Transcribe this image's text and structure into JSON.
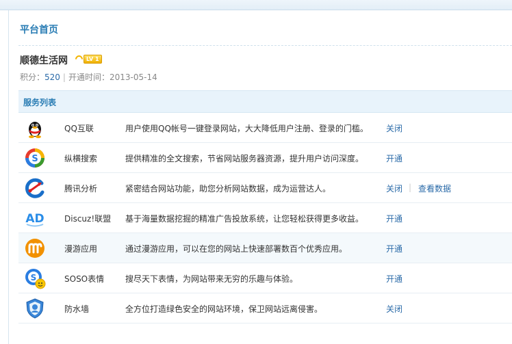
{
  "page": {
    "title": "平台首页"
  },
  "site": {
    "name": "顺德生活网",
    "level_badge": "LV 1",
    "points_label": "积分：",
    "points_value": "520",
    "separator": "|",
    "open_time_label": "开通时间：",
    "open_time_value": "2013-05-14"
  },
  "services": {
    "header": "服务列表",
    "items": [
      {
        "icon": "qq-penguin-icon",
        "name": "QQ互联",
        "desc": "用户使用QQ帐号一键登录网站，大大降低用户注册、登录的门槛。",
        "action": "关闭"
      },
      {
        "icon": "soso-search-icon",
        "name": "纵横搜索",
        "desc": "提供精准的全文搜索，节省网站服务器资源，提升用户访问深度。",
        "action": "开通"
      },
      {
        "icon": "analytics-icon",
        "name": "腾讯分析",
        "desc": "紧密结合网站功能，助您分析网站数据，成为运营达人。",
        "action": "关闭",
        "separator": "|",
        "action2": "查看数据"
      },
      {
        "icon": "ad-icon",
        "name": "Discuz!联盟",
        "desc": "基于海量数据挖掘的精准广告投放系统，让您轻松获得更多收益。",
        "action": "开通"
      },
      {
        "icon": "manyou-icon",
        "name": "漫游应用",
        "desc": "通过漫游应用，可以在您的网站上快速部署数百个优秀应用。",
        "action": "开通"
      },
      {
        "icon": "soso-emoticon-icon",
        "name": "SOSO表情",
        "desc": "搜尽天下表情，为网站带来无穷的乐趣与体验。",
        "action": "开通"
      },
      {
        "icon": "shield-firewall-icon",
        "name": "防水墙",
        "desc": "全方位打造绿色安全的网站环境，保卫网站远离侵害。",
        "action": "关闭"
      }
    ]
  },
  "colors": {
    "accent": "#2a7db4",
    "link": "#2a6aa8",
    "header_bg": "#e8f3fb",
    "alt_row_bg": "#f4f9fc"
  }
}
